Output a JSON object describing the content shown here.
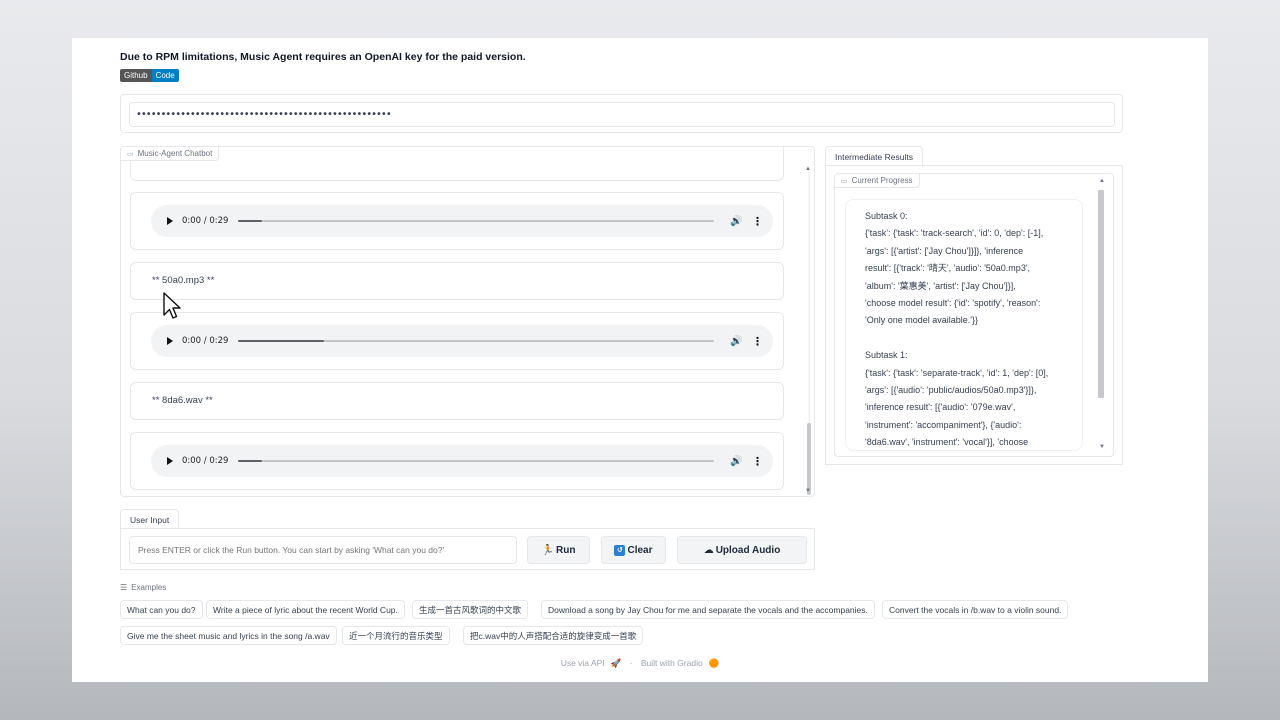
{
  "header": {
    "notice": "Due to RPM limitations, Music Agent requires an OpenAI key for the paid version.",
    "badge_left": "Github",
    "badge_right": "Code"
  },
  "api_key": {
    "value": "••••••••••••••••••••••••••••••••••••••••••••••••••••"
  },
  "chatbot": {
    "label": "Music-Agent Chatbot",
    "messages": [
      {
        "type": "audio",
        "time": "0:00 / 0:29",
        "played": 0.05
      },
      {
        "type": "text",
        "text": "** 50a0.mp3 **"
      },
      {
        "type": "audio",
        "time": "0:00 / 0:29",
        "played": 0.18
      },
      {
        "type": "text",
        "text": "** 8da6.wav **"
      },
      {
        "type": "audio",
        "time": "0:00 / 0:29",
        "played": 0.05
      }
    ]
  },
  "results": {
    "tab": "Intermediate Results",
    "label": "Current Progress",
    "lines": [
      "Subtask 0:",
      "{'task': {'task': 'track-search', 'id': 0, 'dep': [-1],",
      "'args': [{'artist': ['Jay Chou']}]}, 'inference",
      "result': [{'track': '晴天', 'audio': '50a0.mp3',",
      "'album': '葉惠美', 'artist': ['Jay Chou']}],",
      "'choose model result': {'id': 'spotify', 'reason':",
      "'Only one model available.'}}",
      "",
      "Subtask 1:",
      "{'task': {'task': 'separate-track', 'id': 1, 'dep': [0],",
      "'args': [{'audio': 'public/audios/50a0.mp3'}]},",
      "'inference result': [{'audio': '079e.wav',",
      "'instrument': 'accompaniment'}, {'audio':",
      "'8da6.wav', 'instrument': 'vocal'}], 'choose"
    ]
  },
  "user_input": {
    "tab": "User Input",
    "placeholder": "Press ENTER or click the Run button. You can start by asking 'What can you do?'",
    "run_label": "Run",
    "clear_label": "Clear",
    "upload_label": "Upload Audio"
  },
  "examples": {
    "label": "Examples",
    "items": [
      "What can you do?",
      "Write a piece of lyric about the recent World Cup.",
      "生成一首古风歌词的中文歌",
      "Download a song by Jay Chou for me and separate the vocals and the accompanies.",
      "Convert the vocals in /b.wav to a violin sound.",
      "Give me the sheet music and lyrics in the song /a.wav",
      "近一个月流行的音乐类型",
      "把c.wav中的人声搭配合适的旋律变成一首歌"
    ]
  },
  "footer": {
    "api": "Use via API",
    "sep": "·",
    "built": "Built with Gradio"
  }
}
